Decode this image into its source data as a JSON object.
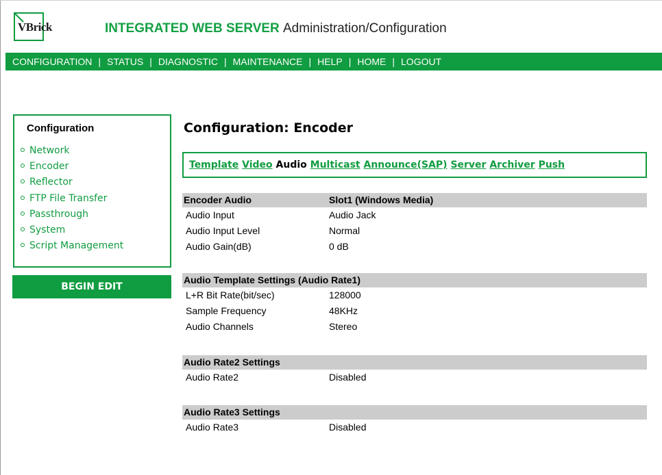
{
  "header": {
    "logo_text": "VBrick",
    "title": "INTEGRATED WEB SERVER",
    "subtitle": "Administration/Configuration"
  },
  "nav": [
    "CONFIGURATION",
    "STATUS",
    "DIAGNOSTIC",
    "MAINTENANCE",
    "HELP",
    "HOME",
    "LOGOUT"
  ],
  "sidebar": {
    "title": "Configuration",
    "items": [
      "Network",
      "Encoder",
      "Reflector",
      "FTP File Transfer",
      "Passthrough",
      "System",
      "Script Management"
    ],
    "begin_edit": "BEGIN EDIT"
  },
  "page_title": "Configuration: Encoder",
  "tabs": [
    {
      "label": "Template",
      "active": false
    },
    {
      "label": "Video",
      "active": false
    },
    {
      "label": "Audio",
      "active": true
    },
    {
      "label": "Multicast",
      "active": false
    },
    {
      "label": "Announce(SAP)",
      "active": false
    },
    {
      "label": "Server",
      "active": false
    },
    {
      "label": "Archiver",
      "active": false
    },
    {
      "label": "Push",
      "active": false
    }
  ],
  "sections": [
    {
      "header": "Encoder Audio",
      "header_value": "Slot1 (Windows Media)",
      "rows": [
        {
          "label": "Audio Input",
          "value": "Audio Jack"
        },
        {
          "label": "Audio Input Level",
          "value": "Normal"
        },
        {
          "label": "Audio Gain(dB)",
          "value": "0 dB"
        }
      ]
    },
    {
      "header": "Audio Template Settings (Audio Rate1)",
      "rows": [
        {
          "label": "L+R Bit Rate(bit/sec)",
          "value": "128000"
        },
        {
          "label": "Sample Frequency",
          "value": "48KHz"
        },
        {
          "label": "Audio Channels",
          "value": "Stereo"
        }
      ]
    },
    {
      "header": "Audio Rate2 Settings",
      "rows": [
        {
          "label": "Audio Rate2",
          "value": "Disabled"
        }
      ]
    },
    {
      "header": "Audio Rate3 Settings",
      "rows": [
        {
          "label": "Audio Rate3",
          "value": "Disabled"
        }
      ]
    }
  ],
  "colors": {
    "brand_green": "#109c40",
    "section_header_bg": "#cccccc"
  }
}
